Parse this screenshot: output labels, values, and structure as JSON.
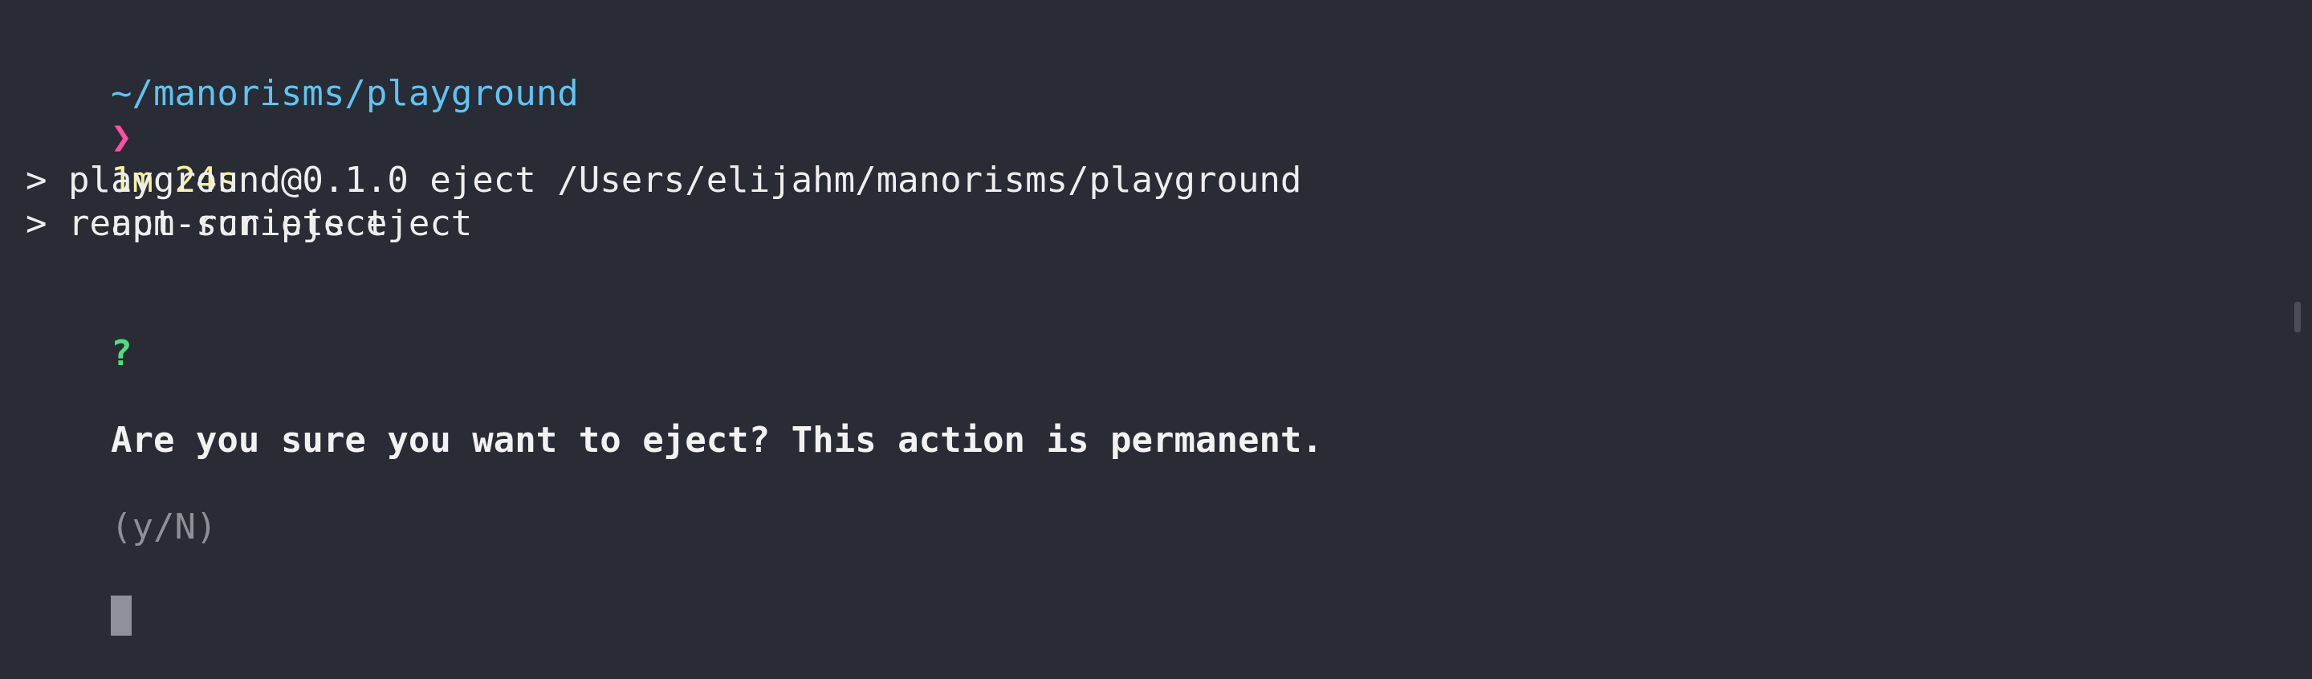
{
  "prompt": {
    "cwd": "~/manorisms/playground",
    "duration": "1m 24s",
    "arrow": "❯",
    "command": "npm run eject"
  },
  "output": {
    "line1": "> playground@0.1.0 eject /Users/elijahm/manorisms/playground",
    "line2": "> react-scripts eject"
  },
  "question": {
    "mark": "?",
    "text": "Are you sure you want to eject? This action is permanent.",
    "hint": "(y/N)"
  },
  "colors": {
    "background": "#292b35",
    "cwd": "#5ec4f2",
    "duration": "#f3f29b",
    "arrow": "#ff4fa3",
    "question_mark": "#4ee07a",
    "hint": "#8f8f98"
  }
}
